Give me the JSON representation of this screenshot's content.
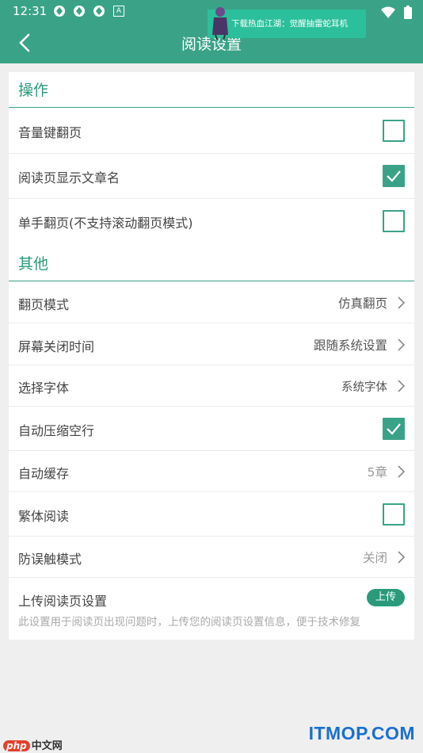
{
  "status_bar": {
    "time": "12:31",
    "notification_badge": "A"
  },
  "app_bar": {
    "title": "阅读设置"
  },
  "ad_banner": {
    "text": "下载热血江湖：觉醒抽雷蛇耳机"
  },
  "sections": {
    "operation": {
      "header": "操作"
    },
    "other": {
      "header": "其他"
    }
  },
  "rows": {
    "volume_key_flip": {
      "label": "音量键翻页",
      "checked": false
    },
    "show_chapter_name": {
      "label": "阅读页显示文章名",
      "checked": true
    },
    "one_hand_flip": {
      "label": "单手翻页(不支持滚动翻页模式)",
      "checked": false
    },
    "flip_mode": {
      "label": "翻页模式",
      "value": "仿真翻页"
    },
    "screen_off_time": {
      "label": "屏幕关闭时间",
      "value": "跟随系统设置"
    },
    "select_font": {
      "label": "选择字体",
      "value": "系统字体"
    },
    "auto_compress_blank": {
      "label": "自动压缩空行",
      "checked": true
    },
    "auto_cache": {
      "label": "自动缓存",
      "value": "5章"
    },
    "traditional_reading": {
      "label": "繁体阅读",
      "checked": false
    },
    "anti_mistouch": {
      "label": "防误触模式",
      "value": "关闭"
    },
    "upload_settings": {
      "label": "上传阅读页设置",
      "button": "上传",
      "description": "此设置用于阅读页出现问题时，上传您的阅读页设置信息，便于技术修复"
    }
  },
  "watermarks": {
    "php_logo": "php",
    "php_text": "中文网",
    "itmop": "ITMOP.COM"
  },
  "colors": {
    "accent": "#3aa387",
    "background": "#efefef"
  }
}
